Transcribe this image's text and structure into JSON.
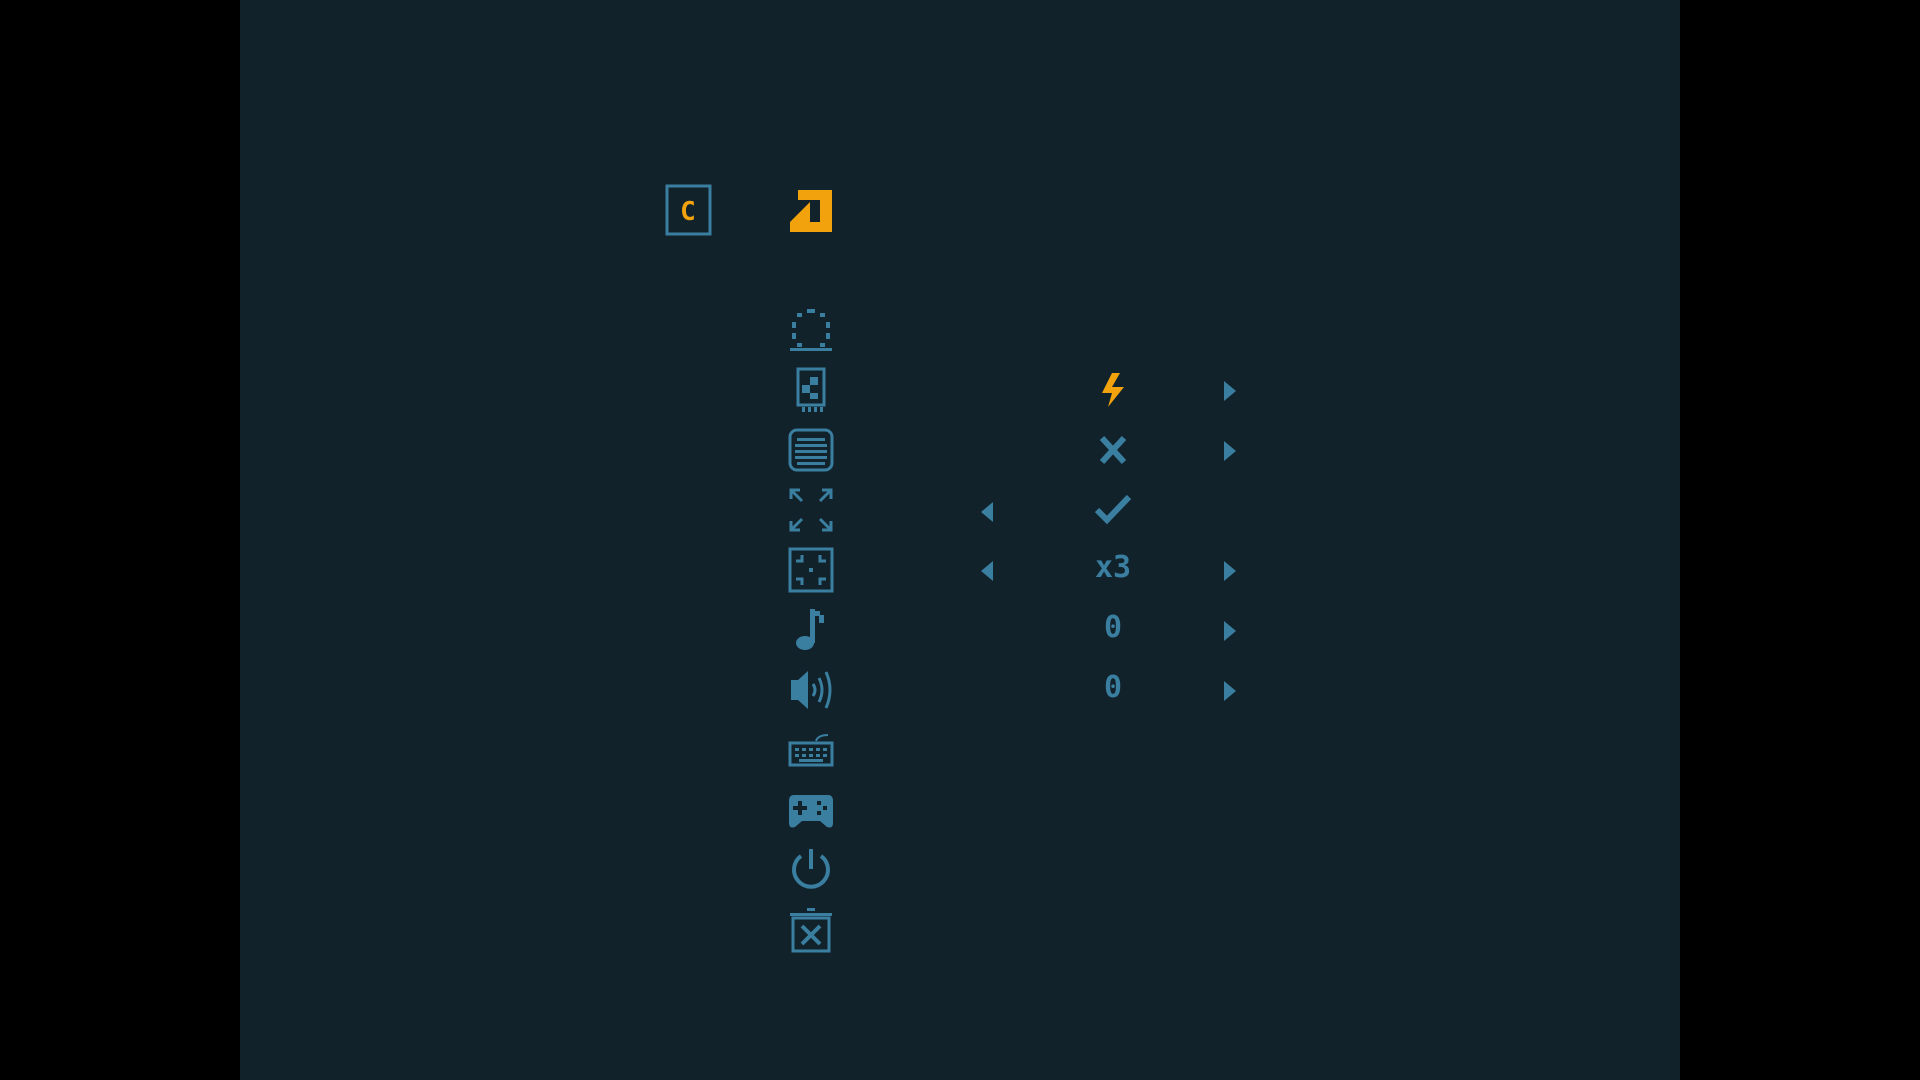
{
  "colors": {
    "background": "#11222b",
    "letterbox": "#000000",
    "icon_blue": "#3a7ea0",
    "accent_orange": "#f2a20d"
  },
  "header": {
    "tab_badge_letter": "C",
    "tab_badge_icon": "tab-c-icon",
    "back_icon": "return-arrow-icon"
  },
  "menu": {
    "items": [
      {
        "icon": "loading-circle-icon",
        "value": "",
        "left_arrow": false,
        "right_arrow": false
      },
      {
        "icon": "cartridge-icon",
        "value_icon": "lightning-icon",
        "value": "",
        "left_arrow": false,
        "right_arrow": true,
        "highlight": true
      },
      {
        "icon": "crt-screen-icon",
        "value_icon": "cross-icon",
        "value": "",
        "left_arrow": false,
        "right_arrow": true
      },
      {
        "icon": "fullscreen-icon",
        "value_icon": "check-icon",
        "value": "",
        "left_arrow": true,
        "right_arrow": false
      },
      {
        "icon": "scale-icon",
        "value": "x3",
        "left_arrow": true,
        "right_arrow": true
      },
      {
        "icon": "music-note-icon",
        "value": "0",
        "left_arrow": false,
        "right_arrow": true
      },
      {
        "icon": "speaker-icon",
        "value": "0",
        "left_arrow": false,
        "right_arrow": true
      },
      {
        "icon": "keyboard-icon",
        "value": "",
        "left_arrow": false,
        "right_arrow": false
      },
      {
        "icon": "gamepad-icon",
        "value": "",
        "left_arrow": false,
        "right_arrow": false
      },
      {
        "icon": "power-icon",
        "value": "",
        "left_arrow": false,
        "right_arrow": false
      },
      {
        "icon": "trash-icon",
        "value": "",
        "left_arrow": false,
        "right_arrow": false
      }
    ]
  }
}
